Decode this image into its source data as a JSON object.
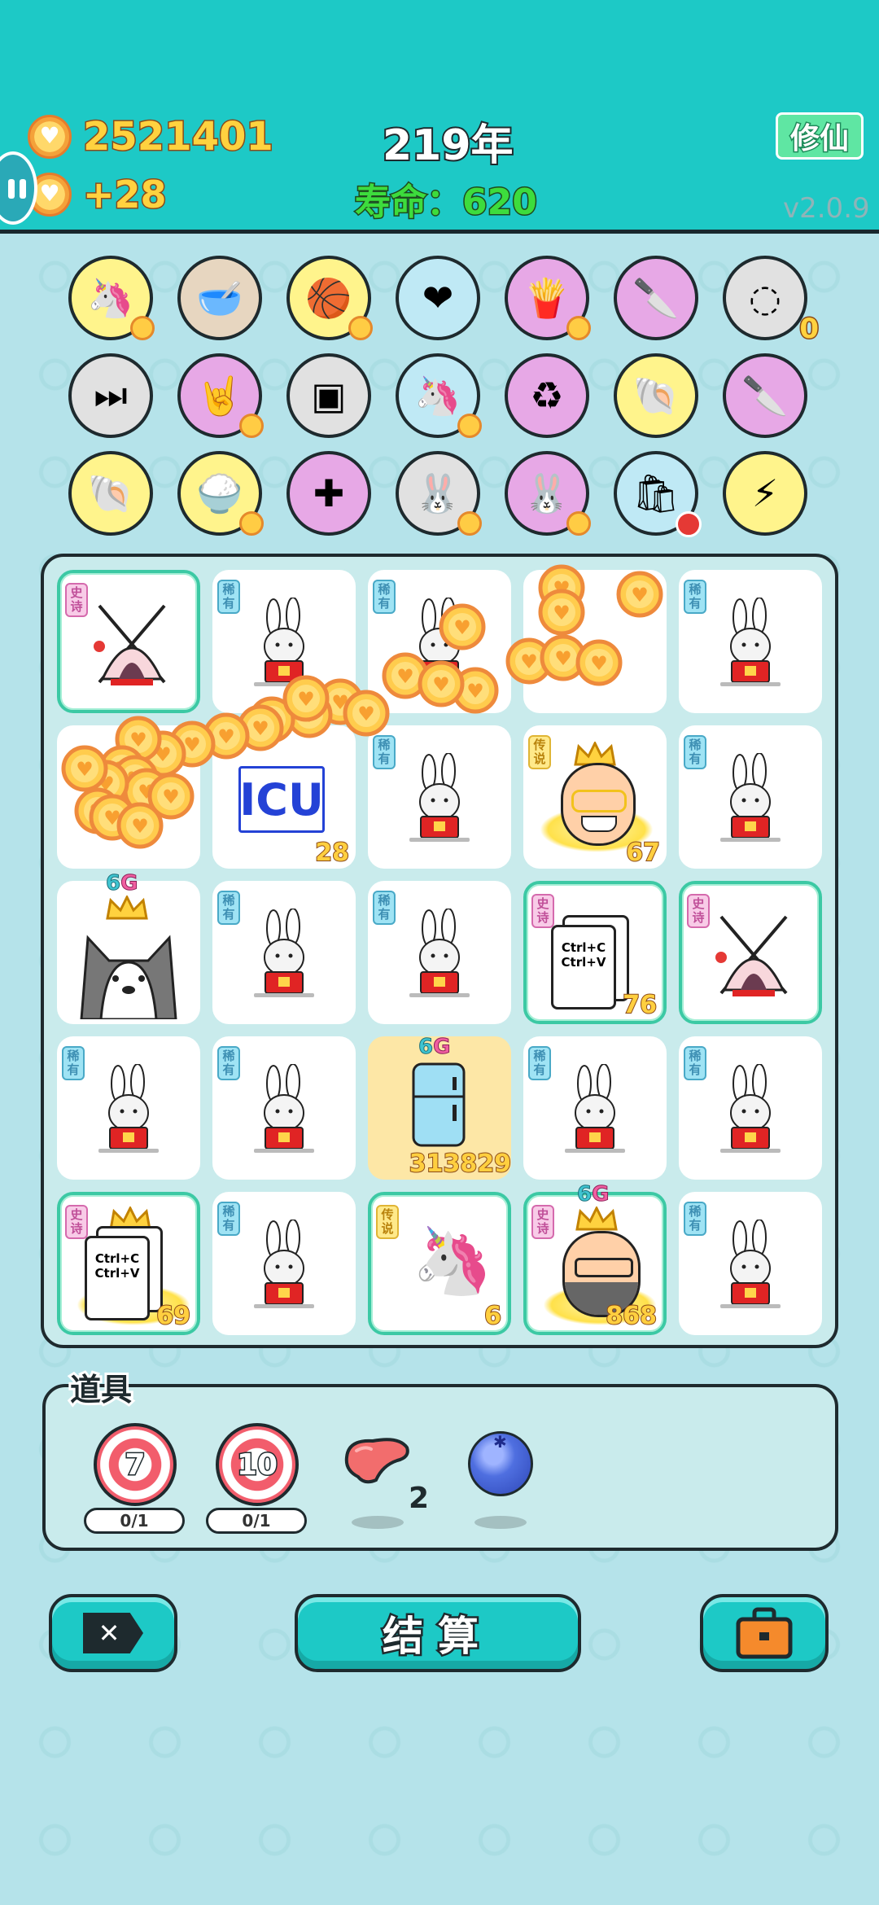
{
  "header": {
    "coins": "2521401",
    "coins_gain": "+28",
    "year": "219年",
    "lifespan": "寿命：620",
    "mode_button": "修仙",
    "version": "v2.0.9"
  },
  "items_row1": [
    {
      "name": "unicorn-icon",
      "bg": "#fff48c"
    },
    {
      "name": "dog-bowl-icon",
      "bg": "#e7d6c0"
    },
    {
      "name": "basketballs-icon",
      "bg": "#fff48c"
    },
    {
      "name": "heart-sign-icon",
      "bg": "#bfe9f5"
    },
    {
      "name": "fries-icon",
      "bg": "#e7a8e6"
    },
    {
      "name": "cleaver-icon",
      "bg": "#e7a8e6"
    },
    {
      "name": "egg-tray-icon",
      "bg": "#e1e1e1",
      "count": "0"
    }
  ],
  "items_row2": [
    {
      "name": "skip-icon",
      "bg": "#e1e1e1"
    },
    {
      "name": "rock-hand-icon",
      "bg": "#e7a8e6"
    },
    {
      "name": "time-magazine-icon",
      "bg": "#e1e1e1"
    },
    {
      "name": "unicorn-pair-icon",
      "bg": "#bfe9f5"
    },
    {
      "name": "recycle-icon",
      "bg": "#e7a8e6"
    },
    {
      "name": "shell-icon",
      "bg": "#fff48c"
    },
    {
      "name": "cleaver-icon",
      "bg": "#e7a8e6"
    }
  ],
  "items_row3": [
    {
      "name": "shell-icon",
      "bg": "#fff48c"
    },
    {
      "name": "rice-bowl-icon",
      "bg": "#fff48c"
    },
    {
      "name": "math-head-icon",
      "bg": "#e7a8e6"
    },
    {
      "name": "bunny-icon",
      "bg": "#e1e1e1"
    },
    {
      "name": "bunny-icon",
      "bg": "#e7a8e6"
    },
    {
      "name": "trash-bag-icon",
      "bg": "#bfe9f5"
    },
    {
      "name": "lightning-icon",
      "bg": "#fff48c"
    }
  ],
  "board": {
    "tags": {
      "rare": "稀有",
      "epic": "史诗",
      "legend": "传说"
    },
    "counts": {
      "icu": "28",
      "boss": "67",
      "ctrl": "76",
      "fridge": "313829",
      "ctrl2": "69",
      "unicorn": "6",
      "dad": "868"
    },
    "gg_label": [
      "6",
      "G"
    ],
    "icu_text": "ICU",
    "ctrl_text": [
      "Ctrl+C",
      "Ctrl+V"
    ]
  },
  "tools": {
    "label": "道具",
    "target1": "7",
    "target2": "10",
    "target1_uses": "0/1",
    "target2_uses": "0/1",
    "liver_count": "2"
  },
  "buttons": {
    "settle": "结算"
  },
  "colors": {
    "accent": "#1dc9c6",
    "gold": "#ffd23f",
    "lifespan": "#3ddc3d"
  }
}
